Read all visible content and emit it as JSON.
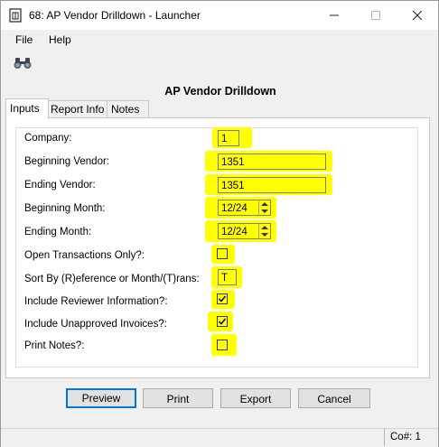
{
  "window": {
    "title": "68: AP Vendor Drilldown - Launcher"
  },
  "menu": {
    "items": [
      "File",
      "Help"
    ]
  },
  "toolbar": {
    "icon": "binoculars-icon"
  },
  "heading": "AP Vendor Drilldown",
  "tabs": [
    "Inputs",
    "Report Info",
    "Notes"
  ],
  "active_tab": "Inputs",
  "fields": {
    "company": {
      "label": "Company:",
      "value": "1"
    },
    "beginning_vendor": {
      "label": "Beginning Vendor:",
      "value": "1351"
    },
    "ending_vendor": {
      "label": "Ending Vendor:",
      "value": "1351"
    },
    "beginning_month": {
      "label": "Beginning Month:",
      "value": "12/24"
    },
    "ending_month": {
      "label": "Ending Month:",
      "value": "12/24"
    },
    "open_transactions": {
      "label": "Open Transactions Only?:",
      "checked": false
    },
    "sort_by": {
      "label": "Sort By (R)eference or Month/(T)rans:",
      "value": "T"
    },
    "include_reviewer": {
      "label": "Include Reviewer Information?:",
      "checked": true
    },
    "include_unapproved": {
      "label": "Include Unapproved Invoices?:",
      "checked": true
    },
    "print_notes": {
      "label": "Print Notes?:",
      "checked": false
    }
  },
  "buttons": {
    "preview": "Preview",
    "print": "Print",
    "export": "Export",
    "cancel": "Cancel"
  },
  "status": {
    "company": "Co#: 1"
  },
  "colors": {
    "highlight": "#ffff00",
    "default_button_border": "#0078d7"
  }
}
